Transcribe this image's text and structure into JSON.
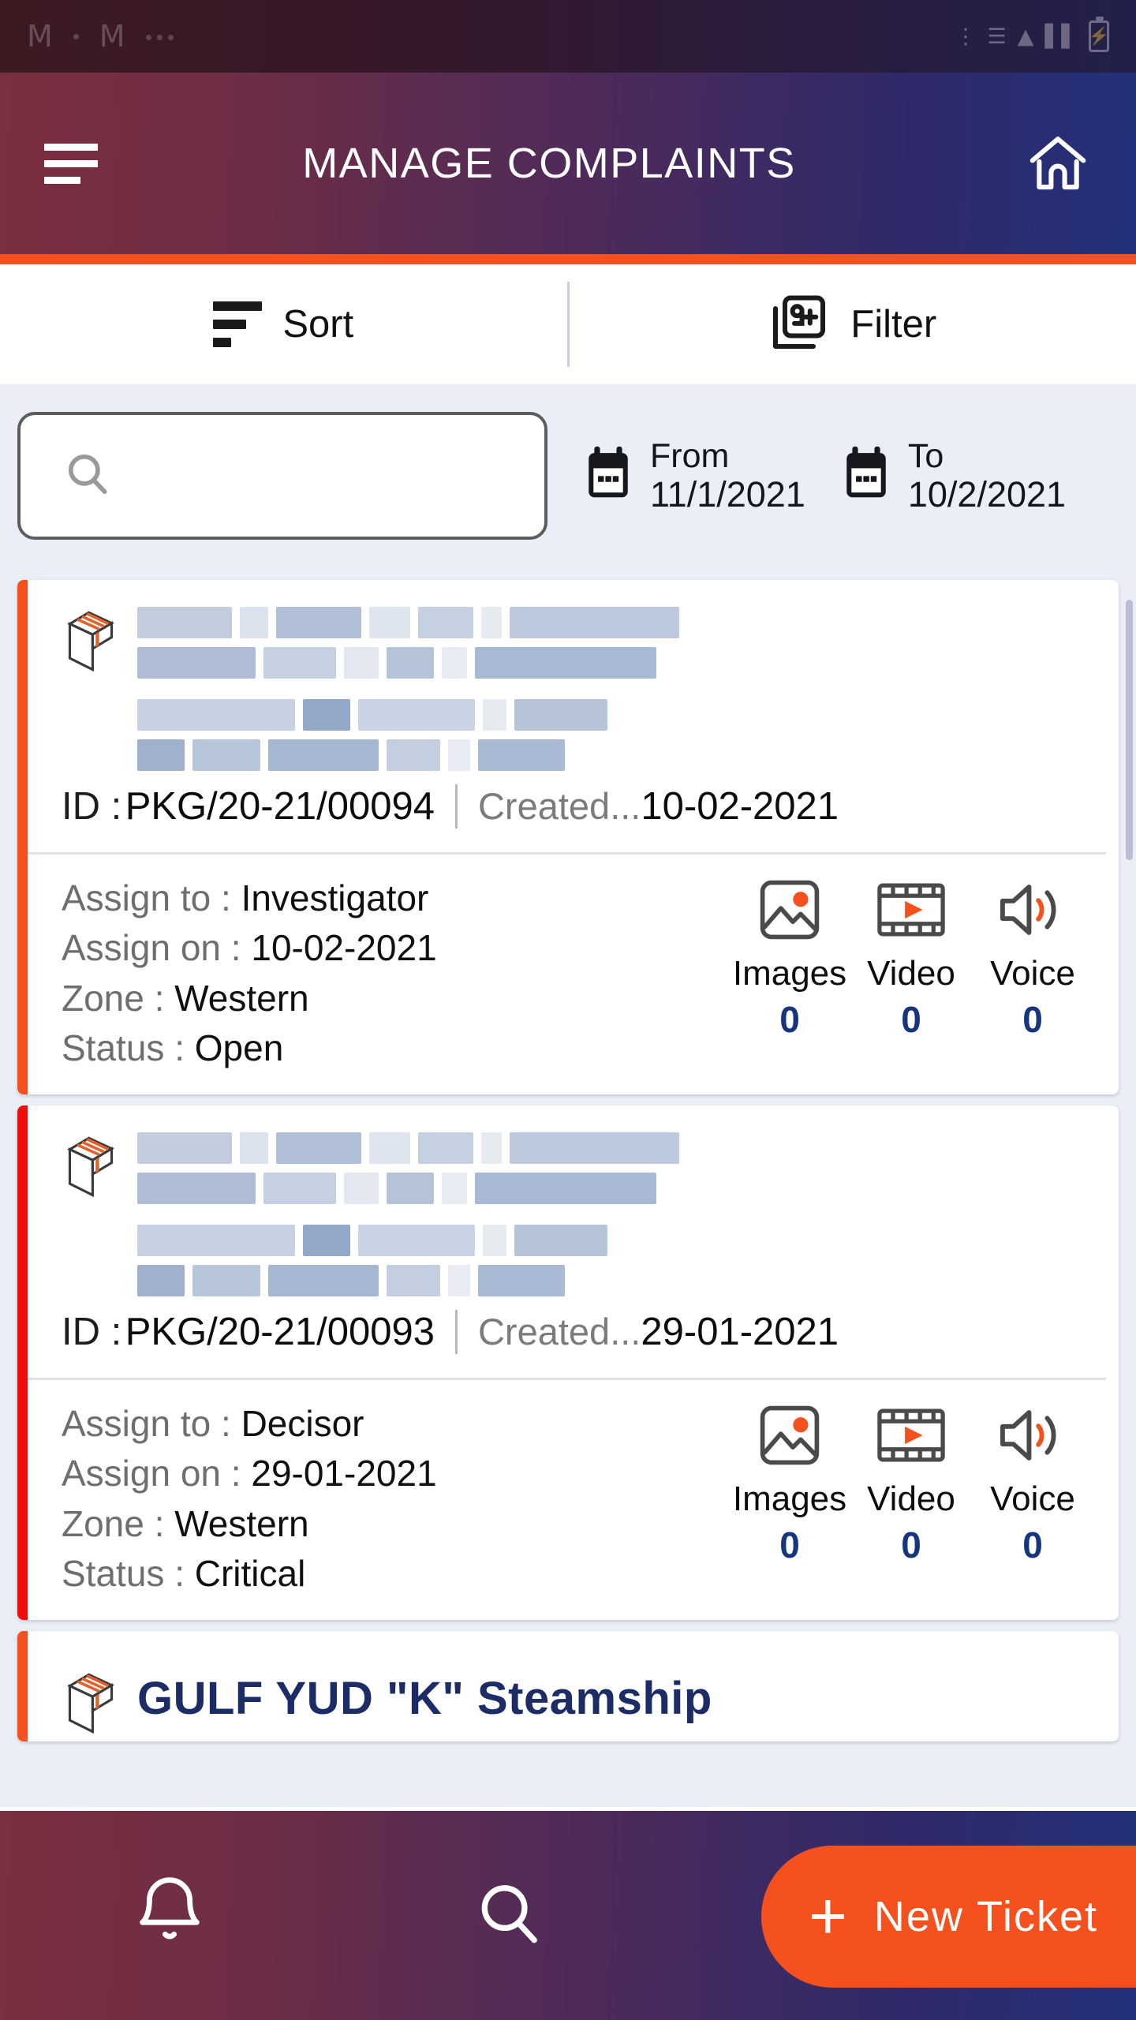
{
  "statusbar": {
    "app_icon_1": "gmail-m-glyph",
    "app_icon_2": "gmail-m-glyph",
    "overflow": "more-notifications-dots",
    "icons": [
      "vibrate-icon",
      "wifi-icon",
      "signal-icon",
      "battery-charging-icon"
    ],
    "battery_glyph": "⚡"
  },
  "header": {
    "menu_icon": "hamburger-menu-icon",
    "title": "MANAGE COMPLAINTS",
    "home_icon": "home-icon",
    "accent_color": "#f4511e"
  },
  "toolbar": {
    "sort_label": "Sort",
    "sort_icon": "sort-icon",
    "filter_label": "Filter",
    "filter_icon": "filter-9-plus-icon",
    "filter_badge": "9+"
  },
  "search": {
    "placeholder": "",
    "value": "",
    "icon": "search-icon"
  },
  "date_range": {
    "from": {
      "label": "From",
      "value": "11/1/2021",
      "icon": "calendar-icon"
    },
    "to": {
      "label": "To",
      "value": "10/2/2021",
      "icon": "calendar-icon"
    }
  },
  "field_labels": {
    "id": "ID :",
    "created": "Created...",
    "assign_to": "Assign to :",
    "assign_on": "Assign on :",
    "zone": "Zone :",
    "status": "Status :"
  },
  "media_labels": {
    "images": "Images",
    "video": "Video",
    "voice": "Voice"
  },
  "colors": {
    "status_open": "#f4511e",
    "status_critical": "#f20d0d",
    "count": "#16357e",
    "accent": "#f4511e"
  },
  "complaints": [
    {
      "stripe_color": "#f4511e",
      "icon": "package-icon",
      "title_redacted": true,
      "id": "PKG/20-21/00094",
      "created": "10-02-2021",
      "assign_to": "Investigator",
      "assign_on": "10-02-2021",
      "zone": "Western",
      "status": "Open",
      "images_count": "0",
      "video_count": "0",
      "voice_count": "0"
    },
    {
      "stripe_color": "#f20d0d",
      "icon": "package-icon",
      "title_redacted": true,
      "id": "PKG/20-21/00093",
      "created": "29-01-2021",
      "assign_to": "Decisor",
      "assign_on": "29-01-2021",
      "zone": "Western",
      "status": "Critical",
      "images_count": "0",
      "video_count": "0",
      "voice_count": "0"
    }
  ],
  "partial_complaint": {
    "stripe_color": "#f4511e",
    "icon": "package-icon",
    "title": "GULF YUD     \"K\" Steamship"
  },
  "bottom_bar": {
    "notifications_icon": "bell-icon",
    "search_icon": "search-icon",
    "new_ticket_label": "New Ticket",
    "new_ticket_plus": "+"
  }
}
